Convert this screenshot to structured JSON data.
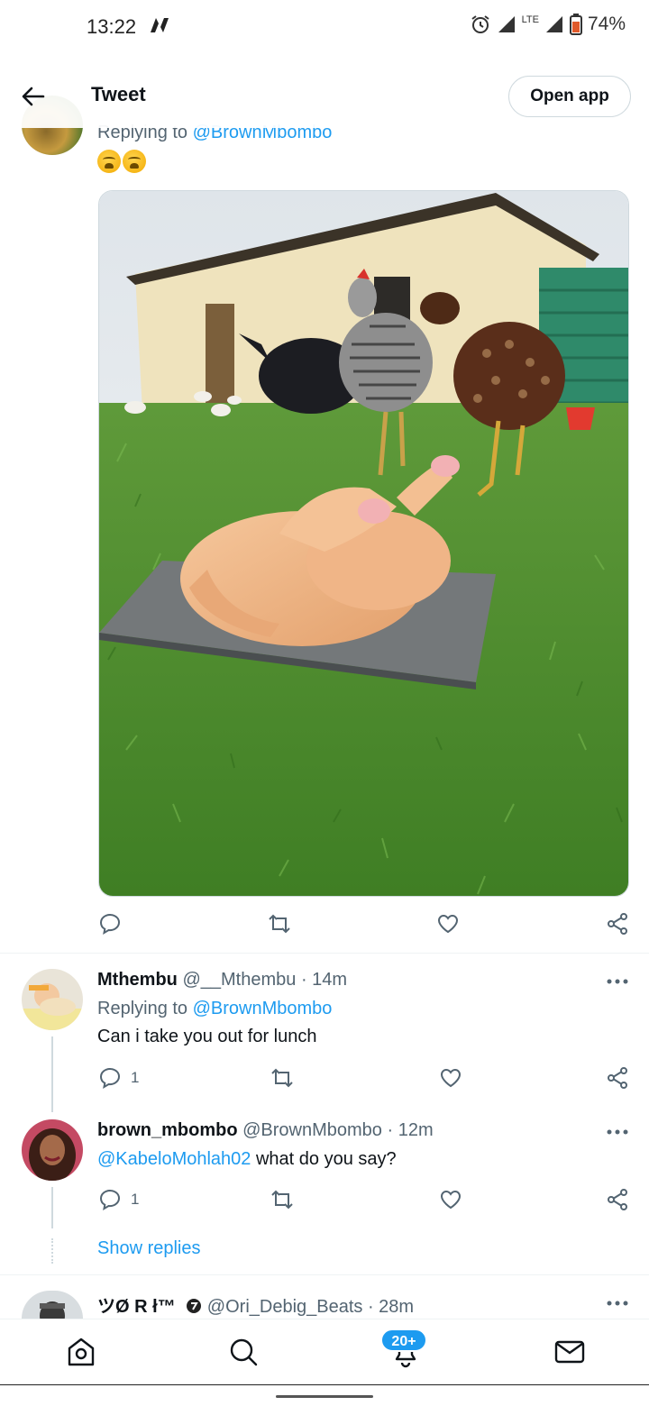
{
  "status_bar": {
    "time": "13:22",
    "network": "LTE",
    "battery": "74%"
  },
  "header": {
    "title": "Tweet",
    "open_app_label": "Open app"
  },
  "main_tweet": {
    "replying_prefix": "Replying to ",
    "replying_handle": "@BrownMbombo",
    "emoji_text": "😩😩",
    "image_alt": "Raw plucked chicken on a metal tray in the grass with live chickens and a turkey behind it"
  },
  "replies": [
    {
      "name": "Mthembu",
      "handle": "@__Mthembu",
      "time": "· 14m",
      "replying_prefix": "Replying to ",
      "replying_handle": "@BrownMbombo",
      "text": "Can i take you out for lunch",
      "reply_count": "1"
    },
    {
      "name": "brown_mbombo",
      "handle": "@BrownMbombo",
      "time": "· 12m",
      "mention": "@KabeloMohlah02",
      "text": " what do you say?",
      "reply_count": "1"
    },
    {
      "name": "ツØ R ł™",
      "handle": "@Ori_Debig_Beats",
      "time": "· 28m"
    }
  ],
  "show_replies_label": "Show replies",
  "bottom_nav": {
    "notifications_badge": "20+",
    "items": [
      "home-icon",
      "search-icon",
      "bell-icon",
      "mail-icon"
    ]
  },
  "colors": {
    "accent": "#1d9bf0",
    "secondary_text": "#536471",
    "primary_text": "#0f1419"
  }
}
